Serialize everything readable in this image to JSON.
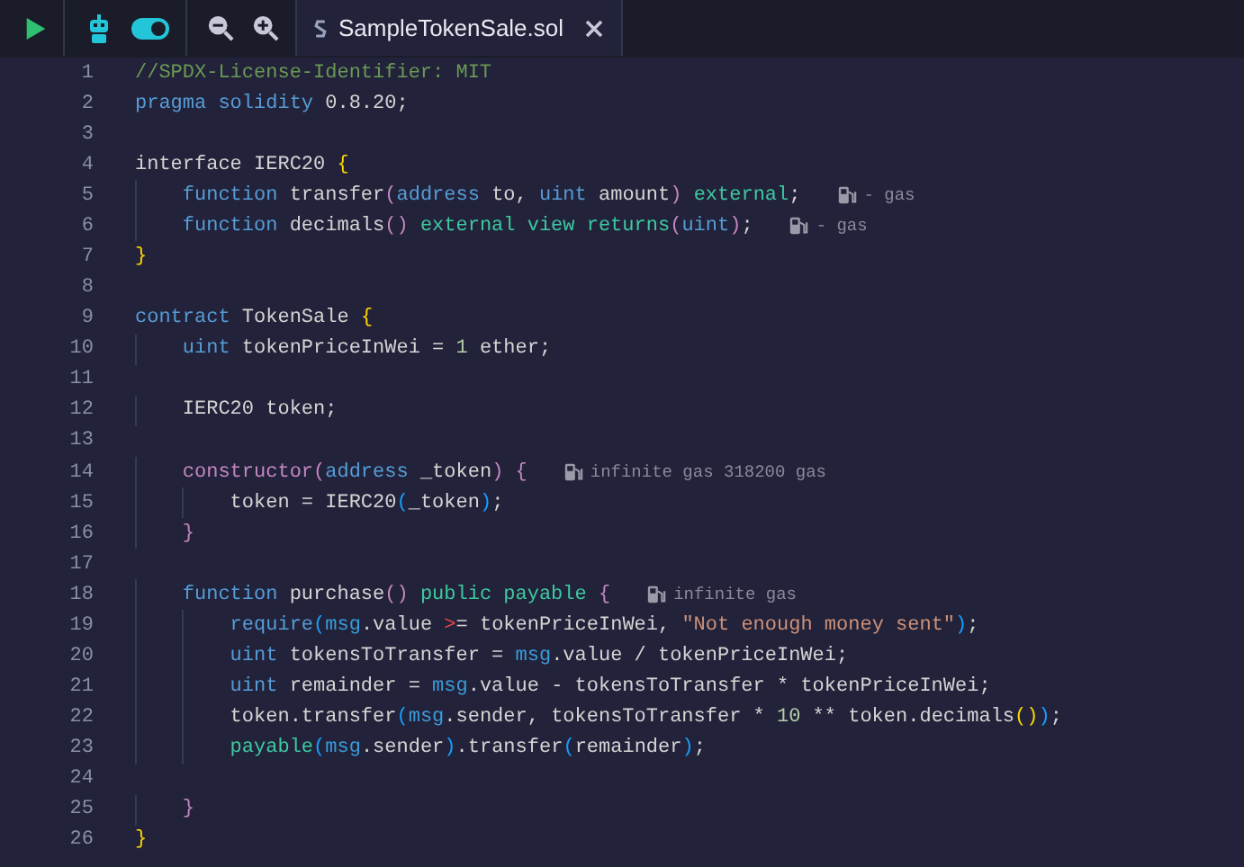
{
  "toolbar": {
    "toggle": {
      "on": true
    }
  },
  "tab": {
    "title": "SampleTokenSale.sol",
    "selected": true
  },
  "lines": [
    {
      "number": "1",
      "tokens": [
        {
          "kind": "c",
          "text": "//SPDX-License-Identifier: MIT"
        }
      ]
    },
    {
      "number": "2",
      "tokens": [
        {
          "kind": "kw",
          "text": "pragma solidity"
        },
        {
          "kind": "p",
          "text": " 0.8.20;"
        }
      ]
    },
    {
      "number": "3"
    },
    {
      "number": "4",
      "tokens": [
        {
          "kind": "p",
          "text": "interface IERC20 "
        },
        {
          "kind": "y",
          "text": "{"
        }
      ]
    },
    {
      "number": "5",
      "tokens": [
        {
          "kind": "kw",
          "text": "    function"
        },
        {
          "kind": "p",
          "text": " transfer"
        },
        {
          "kind": "m",
          "text": "("
        },
        {
          "kind": "kw",
          "text": "address"
        },
        {
          "kind": "p",
          "text": " to, "
        },
        {
          "kind": "kw",
          "text": "uint"
        },
        {
          "kind": "p",
          "text": " amount"
        },
        {
          "kind": "m",
          "text": ")"
        },
        {
          "kind": "g",
          "text": " external"
        },
        {
          "kind": "p",
          "text": ";"
        }
      ],
      "gas": "- gas"
    },
    {
      "number": "6",
      "tokens": [
        {
          "kind": "kw",
          "text": "    function"
        },
        {
          "kind": "p",
          "text": " decimals"
        },
        {
          "kind": "m",
          "text": "()"
        },
        {
          "kind": "g",
          "text": " external view returns"
        },
        {
          "kind": "m",
          "text": "("
        },
        {
          "kind": "kw",
          "text": "uint"
        },
        {
          "kind": "m",
          "text": ")"
        },
        {
          "kind": "p",
          "text": ";"
        }
      ],
      "gas": "- gas"
    },
    {
      "number": "7",
      "tokens": [
        {
          "kind": "y",
          "text": "}"
        }
      ]
    },
    {
      "number": "8"
    },
    {
      "number": "9",
      "tokens": [
        {
          "kind": "kw",
          "text": "contract"
        },
        {
          "kind": "p",
          "text": " TokenSale "
        },
        {
          "kind": "y",
          "text": "{"
        }
      ]
    },
    {
      "number": "10",
      "tokens": [
        {
          "kind": "kw",
          "text": "    uint"
        },
        {
          "kind": "p",
          "text": " tokenPriceInWei = "
        },
        {
          "kind": "n",
          "text": "1"
        },
        {
          "kind": "p",
          "text": " ether;"
        }
      ]
    },
    {
      "number": "11"
    },
    {
      "number": "12",
      "tokens": [
        {
          "kind": "p",
          "text": "    IERC20 token;"
        }
      ]
    },
    {
      "number": "13"
    },
    {
      "number": "14",
      "tokens": [
        {
          "kind": "m",
          "text": "    constructor("
        },
        {
          "kind": "kw",
          "text": "address"
        },
        {
          "kind": "p",
          "text": " _token"
        },
        {
          "kind": "m",
          "text": ") {"
        }
      ],
      "gas": "infinite gas 318200 gas"
    },
    {
      "number": "15",
      "tokens": [
        {
          "kind": "p",
          "text": "        token = IERC20"
        },
        {
          "kind": "b",
          "text": "("
        },
        {
          "kind": "p",
          "text": "_token"
        },
        {
          "kind": "b",
          "text": ")"
        },
        {
          "kind": "p",
          "text": ";"
        }
      ]
    },
    {
      "number": "16",
      "tokens": [
        {
          "kind": "m",
          "text": "    }"
        }
      ]
    },
    {
      "number": "17"
    },
    {
      "number": "18",
      "tokens": [
        {
          "kind": "kw",
          "text": "    function"
        },
        {
          "kind": "p",
          "text": " purchase"
        },
        {
          "kind": "m",
          "text": "()"
        },
        {
          "kind": "g",
          "text": " public payable"
        },
        {
          "kind": "m",
          "text": " {"
        }
      ],
      "gas": "infinite gas"
    },
    {
      "number": "19",
      "tokens": [
        {
          "kind": "kw",
          "text": "        require"
        },
        {
          "kind": "b",
          "text": "("
        },
        {
          "kind": "v",
          "text": "msg"
        },
        {
          "kind": "p",
          "text": ".value "
        },
        {
          "kind": "o",
          "text": ">"
        },
        {
          "kind": "p",
          "text": "= tokenPriceInWei, "
        },
        {
          "kind": "s",
          "text": "\"Not enough money sent\""
        },
        {
          "kind": "b",
          "text": ")"
        },
        {
          "kind": "p",
          "text": ";"
        }
      ]
    },
    {
      "number": "20",
      "tokens": [
        {
          "kind": "kw",
          "text": "        uint"
        },
        {
          "kind": "p",
          "text": " tokensToTransfer = "
        },
        {
          "kind": "v",
          "text": "msg"
        },
        {
          "kind": "p",
          "text": ".value / tokenPriceInWei;"
        }
      ]
    },
    {
      "number": "21",
      "tokens": [
        {
          "kind": "kw",
          "text": "        uint"
        },
        {
          "kind": "p",
          "text": " remainder = "
        },
        {
          "kind": "v",
          "text": "msg"
        },
        {
          "kind": "p",
          "text": ".value - tokensToTransfer * tokenPriceInWei;"
        }
      ]
    },
    {
      "number": "22",
      "tokens": [
        {
          "kind": "p",
          "text": "        token.transfer"
        },
        {
          "kind": "b",
          "text": "("
        },
        {
          "kind": "v",
          "text": "msg"
        },
        {
          "kind": "p",
          "text": ".sender, tokensToTransfer * "
        },
        {
          "kind": "n",
          "text": "10"
        },
        {
          "kind": "p",
          "text": " ** token.decimals"
        },
        {
          "kind": "y",
          "text": "()"
        },
        {
          "kind": "b",
          "text": ")"
        },
        {
          "kind": "p",
          "text": ";"
        }
      ]
    },
    {
      "number": "23",
      "tokens": [
        {
          "kind": "g",
          "text": "        payable"
        },
        {
          "kind": "b",
          "text": "("
        },
        {
          "kind": "v",
          "text": "msg"
        },
        {
          "kind": "p",
          "text": ".sender"
        },
        {
          "kind": "b",
          "text": ")"
        },
        {
          "kind": "p",
          "text": ".transfer"
        },
        {
          "kind": "b",
          "text": "("
        },
        {
          "kind": "p",
          "text": "remainder"
        },
        {
          "kind": "b",
          "text": ")"
        },
        {
          "kind": "p",
          "text": ";"
        }
      ]
    },
    {
      "number": "24"
    },
    {
      "number": "25",
      "tokens": [
        {
          "kind": "m",
          "text": "    }"
        }
      ]
    },
    {
      "number": "26",
      "tokens": [
        {
          "kind": "y",
          "text": "}"
        }
      ]
    }
  ]
}
